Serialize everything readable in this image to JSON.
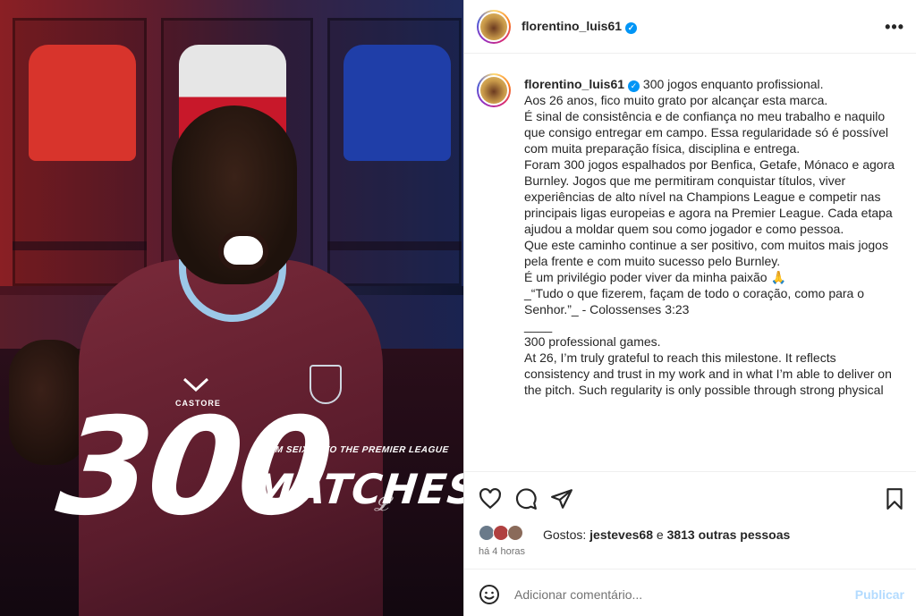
{
  "post": {
    "username": "florentino_luis61",
    "verified_mark": "✓",
    "more_icon": "•••",
    "image": {
      "big_number": "300",
      "subline": "FROM SEIXAL TO THE PREMIER LEAGUE",
      "matches": "MATCHES",
      "kit_brand": "CASTORE"
    },
    "caption_lines": [
      "300 jogos enquanto profissional.",
      "Aos 26 anos, fico muito grato por alcançar esta marca.",
      "É sinal de consistência e de confiança no meu trabalho e naquilo que consigo entregar em campo. Essa regularidade só é possível com muita preparação física, disciplina e entrega.",
      "",
      "Foram 300 jogos espalhados por Benfica, Getafe, Mónaco e agora Burnley. Jogos que me permitiram conquistar títulos, viver experiências de alto nível na Champions League e competir nas principais ligas europeias e agora na Premier League. Cada etapa ajudou a moldar quem sou como jogador e como pessoa.",
      "",
      "Que este caminho continue a ser positivo, com muitos mais jogos pela frente e com muito sucesso pelo Burnley.",
      "É um privilégio poder viver da minha paixão 🙏",
      "",
      "_“Tudo o que fizerem, façam de todo o coração, como para o Senhor.”_ - Colossenses 3:23",
      "",
      "____",
      "",
      "300 professional games.",
      "At 26, I’m truly grateful to reach this milestone. It reflects consistency and trust in my work and in what I’m able to deliver on the pitch. Such regularity is only possible through strong physical"
    ],
    "likes": {
      "prefix": "Gostos:",
      "liker": "jesteves68",
      "joiner": "e",
      "others": "3813 outras pessoas"
    },
    "time_ago": "há 4 horas",
    "comment": {
      "placeholder": "Adicionar comentário...",
      "value": "",
      "publish_label": "Publicar"
    }
  },
  "colors": {
    "text": "#262626",
    "muted": "#737373",
    "verified": "#0095f6",
    "publish_disabled": "#b3dbff"
  },
  "icons": [
    "more-horizontal-icon",
    "heart-icon",
    "comment-icon",
    "share-icon",
    "bookmark-icon",
    "emoji-icon",
    "verified-badge-icon"
  ]
}
